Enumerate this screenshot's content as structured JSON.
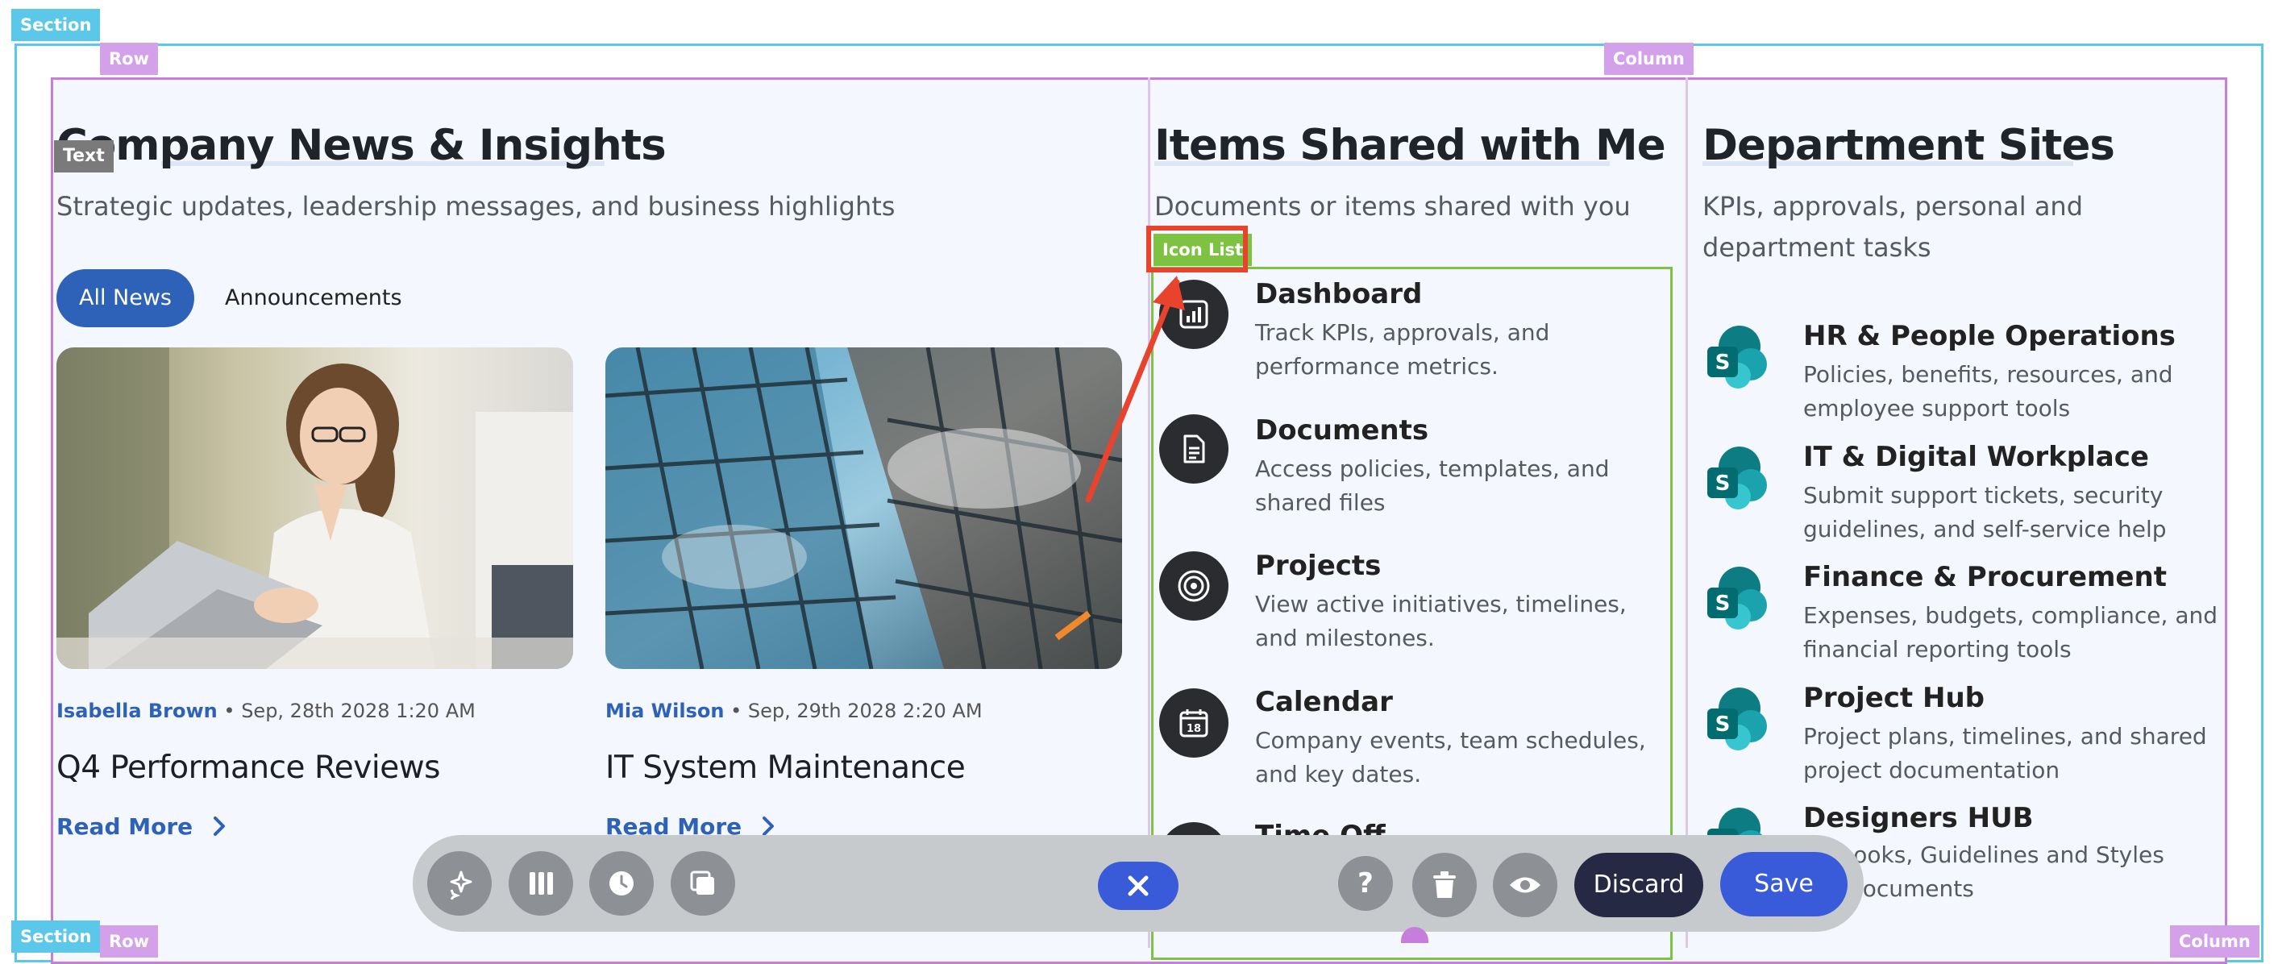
{
  "editor": {
    "section_tag": "Section",
    "row_tag": "Row",
    "column_tag": "Column",
    "text_tag": "Text",
    "icon_list_tag": "Icon List",
    "bottom_section_tag": "Section",
    "bottom_row_tag": "Row",
    "bottom_column_tag": "Column"
  },
  "news": {
    "title": "Company News & Insights",
    "subtitle": "Strategic updates, leadership messages, and business highlights",
    "tabs": [
      "All News",
      "Announcements"
    ],
    "posts": [
      {
        "author": "Isabella Brown",
        "date": "Sep, 28th 2028 1:20 AM",
        "title": "Q4 Performance Reviews",
        "read_more": "Read More"
      },
      {
        "author": "Mia Wilson",
        "date": "Sep, 29th 2028 2:20 AM",
        "title": "IT System Maintenance",
        "read_more": "Read More"
      }
    ]
  },
  "shared": {
    "title": "Items Shared with Me",
    "subtitle": "Documents or items shared with you",
    "items": [
      {
        "icon": "dashboard-icon",
        "title": "Dashboard",
        "desc": "Track KPIs, approvals, and performance metrics."
      },
      {
        "icon": "document-icon",
        "title": "Documents",
        "desc": "Access policies, templates, and shared files"
      },
      {
        "icon": "target-icon",
        "title": "Projects",
        "desc": "View active initiatives, timelines, and milestones."
      },
      {
        "icon": "calendar-icon",
        "title": "Calendar",
        "desc": "Company events, team schedules, and key dates.",
        "icon_text": "18"
      },
      {
        "icon": "time-off-icon",
        "title": "Time Off"
      }
    ]
  },
  "departments": {
    "title": "Department Sites",
    "subtitle": "KPIs, approvals, personal and department tasks",
    "sites": [
      {
        "title": "HR & People Operations",
        "desc": "Policies, benefits, resources, and employee support tools"
      },
      {
        "title": "IT & Digital Workplace",
        "desc": "Submit support tickets, security guidelines, and self-service help"
      },
      {
        "title": "Finance & Procurement",
        "desc": "Expenses, budgets, compliance, and financial reporting tools"
      },
      {
        "title": "Project Hub",
        "desc": "Project plans, timelines, and shared project documentation"
      },
      {
        "title": "Designers HUB",
        "desc": "...dbooks, Guidelines and Styles",
        "desc2": "...y Documents"
      }
    ],
    "sp_letter": "S"
  },
  "toolbar": {
    "discard_label": "Discard",
    "save_label": "Save",
    "help_label": "?"
  },
  "colors": {
    "accent_blue": "#2e62b8",
    "save_blue": "#3a5bd9",
    "discard_navy": "#262944",
    "section_cyan": "#5bc8ea",
    "row_purple": "#c77ddc",
    "icon_list_green": "#7dc240",
    "annotation_red": "#e8432d"
  }
}
